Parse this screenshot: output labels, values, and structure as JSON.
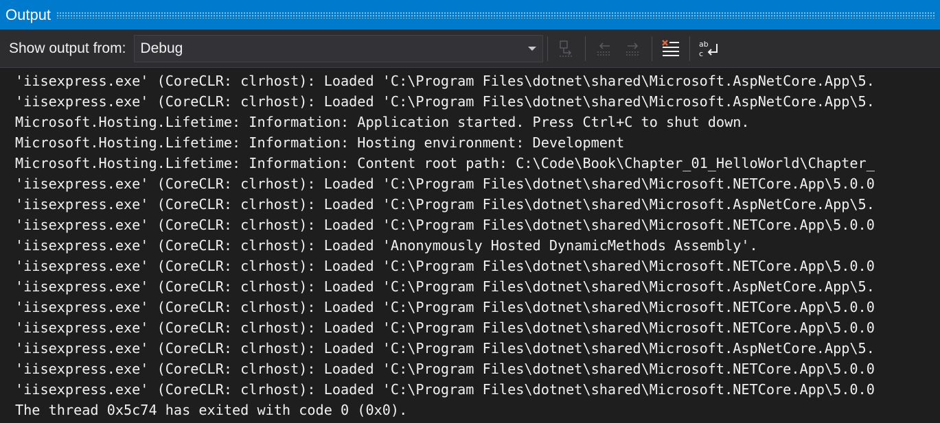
{
  "window": {
    "title": "Output"
  },
  "toolbar": {
    "show_output_label": "Show output from:",
    "source_select": {
      "value": "Debug"
    },
    "buttons": [
      {
        "name": "find-message-in-code-button",
        "icon": "goto-source-icon",
        "enabled": false
      },
      {
        "name": "previous-message-button",
        "icon": "arrow-left-icon",
        "enabled": false
      },
      {
        "name": "next-message-button",
        "icon": "arrow-right-icon",
        "enabled": false
      },
      {
        "name": "clear-all-button",
        "icon": "clear-all-icon",
        "enabled": true
      },
      {
        "name": "toggle-word-wrap-button",
        "icon": "word-wrap-icon",
        "enabled": true
      }
    ]
  },
  "output": {
    "lines": [
      "'iisexpress.exe' (CoreCLR: clrhost): Loaded 'C:\\Program Files\\dotnet\\shared\\Microsoft.AspNetCore.App\\5.",
      "'iisexpress.exe' (CoreCLR: clrhost): Loaded 'C:\\Program Files\\dotnet\\shared\\Microsoft.AspNetCore.App\\5.",
      "Microsoft.Hosting.Lifetime: Information: Application started. Press Ctrl+C to shut down.",
      "Microsoft.Hosting.Lifetime: Information: Hosting environment: Development",
      "Microsoft.Hosting.Lifetime: Information: Content root path: C:\\Code\\Book\\Chapter_01_HelloWorld\\Chapter_",
      "'iisexpress.exe' (CoreCLR: clrhost): Loaded 'C:\\Program Files\\dotnet\\shared\\Microsoft.NETCore.App\\5.0.0",
      "'iisexpress.exe' (CoreCLR: clrhost): Loaded 'C:\\Program Files\\dotnet\\shared\\Microsoft.AspNetCore.App\\5.",
      "'iisexpress.exe' (CoreCLR: clrhost): Loaded 'C:\\Program Files\\dotnet\\shared\\Microsoft.NETCore.App\\5.0.0",
      "'iisexpress.exe' (CoreCLR: clrhost): Loaded 'Anonymously Hosted DynamicMethods Assembly'.",
      "'iisexpress.exe' (CoreCLR: clrhost): Loaded 'C:\\Program Files\\dotnet\\shared\\Microsoft.NETCore.App\\5.0.0",
      "'iisexpress.exe' (CoreCLR: clrhost): Loaded 'C:\\Program Files\\dotnet\\shared\\Microsoft.AspNetCore.App\\5.",
      "'iisexpress.exe' (CoreCLR: clrhost): Loaded 'C:\\Program Files\\dotnet\\shared\\Microsoft.NETCore.App\\5.0.0",
      "'iisexpress.exe' (CoreCLR: clrhost): Loaded 'C:\\Program Files\\dotnet\\shared\\Microsoft.NETCore.App\\5.0.0",
      "'iisexpress.exe' (CoreCLR: clrhost): Loaded 'C:\\Program Files\\dotnet\\shared\\Microsoft.AspNetCore.App\\5.",
      "'iisexpress.exe' (CoreCLR: clrhost): Loaded 'C:\\Program Files\\dotnet\\shared\\Microsoft.NETCore.App\\5.0.0",
      "'iisexpress.exe' (CoreCLR: clrhost): Loaded 'C:\\Program Files\\dotnet\\shared\\Microsoft.NETCore.App\\5.0.0",
      "The thread 0x5c74 has exited with code 0 (0x0)."
    ]
  },
  "colors": {
    "title_bar": "#007acc",
    "toolbar_bg": "#2d2d30",
    "output_bg": "#1e1e1e",
    "text": "#f1f1f1"
  }
}
